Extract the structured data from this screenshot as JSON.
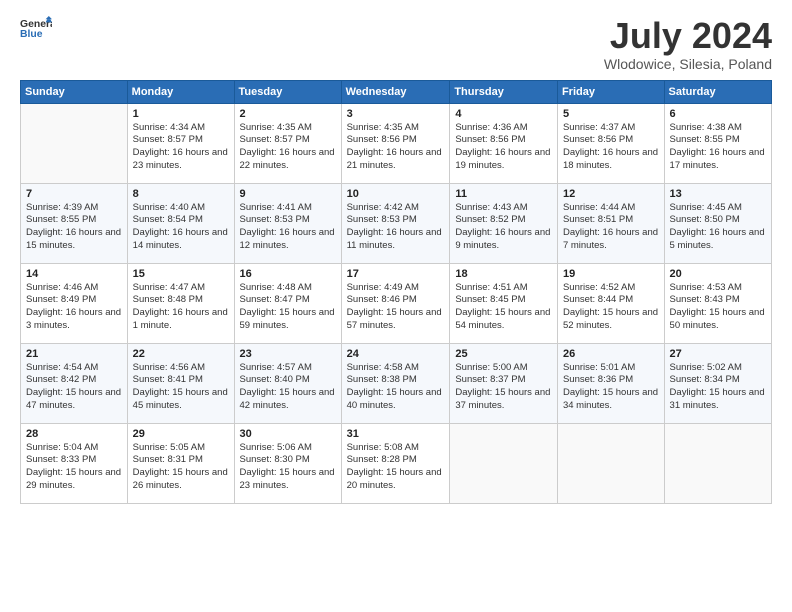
{
  "header": {
    "logo_line1": "General",
    "logo_line2": "Blue",
    "title": "July 2024",
    "location": "Wlodowice, Silesia, Poland"
  },
  "weekdays": [
    "Sunday",
    "Monday",
    "Tuesday",
    "Wednesday",
    "Thursday",
    "Friday",
    "Saturday"
  ],
  "weeks": [
    [
      {
        "day": "",
        "sunrise": "",
        "sunset": "",
        "daylight": ""
      },
      {
        "day": "1",
        "sunrise": "Sunrise: 4:34 AM",
        "sunset": "Sunset: 8:57 PM",
        "daylight": "Daylight: 16 hours and 23 minutes."
      },
      {
        "day": "2",
        "sunrise": "Sunrise: 4:35 AM",
        "sunset": "Sunset: 8:57 PM",
        "daylight": "Daylight: 16 hours and 22 minutes."
      },
      {
        "day": "3",
        "sunrise": "Sunrise: 4:35 AM",
        "sunset": "Sunset: 8:56 PM",
        "daylight": "Daylight: 16 hours and 21 minutes."
      },
      {
        "day": "4",
        "sunrise": "Sunrise: 4:36 AM",
        "sunset": "Sunset: 8:56 PM",
        "daylight": "Daylight: 16 hours and 19 minutes."
      },
      {
        "day": "5",
        "sunrise": "Sunrise: 4:37 AM",
        "sunset": "Sunset: 8:56 PM",
        "daylight": "Daylight: 16 hours and 18 minutes."
      },
      {
        "day": "6",
        "sunrise": "Sunrise: 4:38 AM",
        "sunset": "Sunset: 8:55 PM",
        "daylight": "Daylight: 16 hours and 17 minutes."
      }
    ],
    [
      {
        "day": "7",
        "sunrise": "Sunrise: 4:39 AM",
        "sunset": "Sunset: 8:55 PM",
        "daylight": "Daylight: 16 hours and 15 minutes."
      },
      {
        "day": "8",
        "sunrise": "Sunrise: 4:40 AM",
        "sunset": "Sunset: 8:54 PM",
        "daylight": "Daylight: 16 hours and 14 minutes."
      },
      {
        "day": "9",
        "sunrise": "Sunrise: 4:41 AM",
        "sunset": "Sunset: 8:53 PM",
        "daylight": "Daylight: 16 hours and 12 minutes."
      },
      {
        "day": "10",
        "sunrise": "Sunrise: 4:42 AM",
        "sunset": "Sunset: 8:53 PM",
        "daylight": "Daylight: 16 hours and 11 minutes."
      },
      {
        "day": "11",
        "sunrise": "Sunrise: 4:43 AM",
        "sunset": "Sunset: 8:52 PM",
        "daylight": "Daylight: 16 hours and 9 minutes."
      },
      {
        "day": "12",
        "sunrise": "Sunrise: 4:44 AM",
        "sunset": "Sunset: 8:51 PM",
        "daylight": "Daylight: 16 hours and 7 minutes."
      },
      {
        "day": "13",
        "sunrise": "Sunrise: 4:45 AM",
        "sunset": "Sunset: 8:50 PM",
        "daylight": "Daylight: 16 hours and 5 minutes."
      }
    ],
    [
      {
        "day": "14",
        "sunrise": "Sunrise: 4:46 AM",
        "sunset": "Sunset: 8:49 PM",
        "daylight": "Daylight: 16 hours and 3 minutes."
      },
      {
        "day": "15",
        "sunrise": "Sunrise: 4:47 AM",
        "sunset": "Sunset: 8:48 PM",
        "daylight": "Daylight: 16 hours and 1 minute."
      },
      {
        "day": "16",
        "sunrise": "Sunrise: 4:48 AM",
        "sunset": "Sunset: 8:47 PM",
        "daylight": "Daylight: 15 hours and 59 minutes."
      },
      {
        "day": "17",
        "sunrise": "Sunrise: 4:49 AM",
        "sunset": "Sunset: 8:46 PM",
        "daylight": "Daylight: 15 hours and 57 minutes."
      },
      {
        "day": "18",
        "sunrise": "Sunrise: 4:51 AM",
        "sunset": "Sunset: 8:45 PM",
        "daylight": "Daylight: 15 hours and 54 minutes."
      },
      {
        "day": "19",
        "sunrise": "Sunrise: 4:52 AM",
        "sunset": "Sunset: 8:44 PM",
        "daylight": "Daylight: 15 hours and 52 minutes."
      },
      {
        "day": "20",
        "sunrise": "Sunrise: 4:53 AM",
        "sunset": "Sunset: 8:43 PM",
        "daylight": "Daylight: 15 hours and 50 minutes."
      }
    ],
    [
      {
        "day": "21",
        "sunrise": "Sunrise: 4:54 AM",
        "sunset": "Sunset: 8:42 PM",
        "daylight": "Daylight: 15 hours and 47 minutes."
      },
      {
        "day": "22",
        "sunrise": "Sunrise: 4:56 AM",
        "sunset": "Sunset: 8:41 PM",
        "daylight": "Daylight: 15 hours and 45 minutes."
      },
      {
        "day": "23",
        "sunrise": "Sunrise: 4:57 AM",
        "sunset": "Sunset: 8:40 PM",
        "daylight": "Daylight: 15 hours and 42 minutes."
      },
      {
        "day": "24",
        "sunrise": "Sunrise: 4:58 AM",
        "sunset": "Sunset: 8:38 PM",
        "daylight": "Daylight: 15 hours and 40 minutes."
      },
      {
        "day": "25",
        "sunrise": "Sunrise: 5:00 AM",
        "sunset": "Sunset: 8:37 PM",
        "daylight": "Daylight: 15 hours and 37 minutes."
      },
      {
        "day": "26",
        "sunrise": "Sunrise: 5:01 AM",
        "sunset": "Sunset: 8:36 PM",
        "daylight": "Daylight: 15 hours and 34 minutes."
      },
      {
        "day": "27",
        "sunrise": "Sunrise: 5:02 AM",
        "sunset": "Sunset: 8:34 PM",
        "daylight": "Daylight: 15 hours and 31 minutes."
      }
    ],
    [
      {
        "day": "28",
        "sunrise": "Sunrise: 5:04 AM",
        "sunset": "Sunset: 8:33 PM",
        "daylight": "Daylight: 15 hours and 29 minutes."
      },
      {
        "day": "29",
        "sunrise": "Sunrise: 5:05 AM",
        "sunset": "Sunset: 8:31 PM",
        "daylight": "Daylight: 15 hours and 26 minutes."
      },
      {
        "day": "30",
        "sunrise": "Sunrise: 5:06 AM",
        "sunset": "Sunset: 8:30 PM",
        "daylight": "Daylight: 15 hours and 23 minutes."
      },
      {
        "day": "31",
        "sunrise": "Sunrise: 5:08 AM",
        "sunset": "Sunset: 8:28 PM",
        "daylight": "Daylight: 15 hours and 20 minutes."
      },
      {
        "day": "",
        "sunrise": "",
        "sunset": "",
        "daylight": ""
      },
      {
        "day": "",
        "sunrise": "",
        "sunset": "",
        "daylight": ""
      },
      {
        "day": "",
        "sunrise": "",
        "sunset": "",
        "daylight": ""
      }
    ]
  ]
}
